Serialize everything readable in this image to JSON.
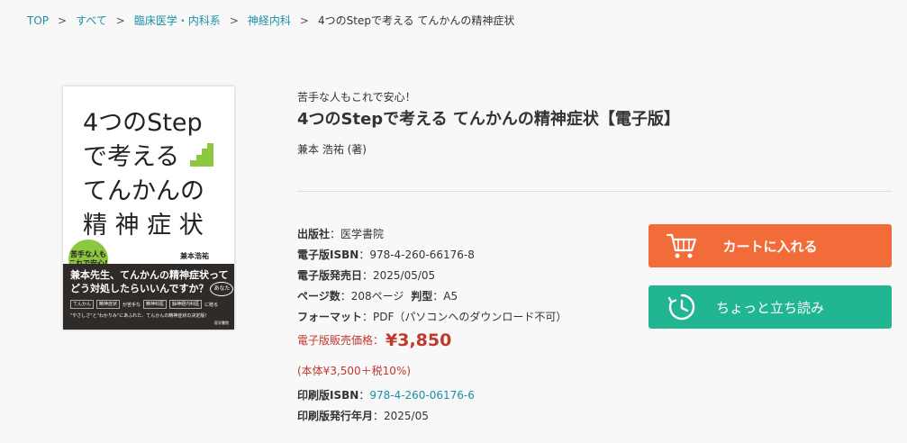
{
  "breadcrumb": {
    "items": [
      "TOP",
      "すべて",
      "臨床医学・内科系",
      "神経内科"
    ],
    "current": "4つのStepで考える てんかんの精神症状"
  },
  "cover": {
    "title_lines": [
      "4つのStep",
      "で考える",
      "てんかんの",
      "精 神 症 状"
    ],
    "badge": [
      "苦手な人も",
      "これで安心!"
    ],
    "author": "兼本浩祐",
    "band_line1": "兼本先生、てんかんの精神症状って",
    "band_line2": "どう対処したらいいんですか？",
    "band_ring": "あなた",
    "band_tags": [
      "てんかん",
      "精神症状",
      "精神科医",
      "脳神経内科医"
    ],
    "band_tag_mid": "が苦手な",
    "band_tag_end": "に贈る",
    "band_line4": "\"やさしさ\"と\"わかりみ\"にあふれた、てんかんの精神症状の決定版！",
    "band_publisher": "医学書院"
  },
  "product": {
    "subtitle": "苦手な人もこれで安心！",
    "title": "4つのStepで考える てんかんの精神症状【電子版】",
    "authors": "兼本 浩祐 (著)"
  },
  "details": {
    "publisher_label": "出版社",
    "publisher_value": "：医学書院",
    "e_isbn_label": "電子版ISBN",
    "e_isbn_value": "：978-4-260-66176-8",
    "e_release_label": "電子版発売日",
    "e_release_value": "：2025/05/05",
    "pages_label": "ページ数",
    "pages_value": "：208ページ",
    "size_label": "判型",
    "size_value": "：A5",
    "format_label": "フォーマット",
    "format_value": "：PDF（パソコンへのダウンロード不可）",
    "price_label": "電子版販売価格：",
    "price_value": "¥3,850",
    "price_breakdown": "(本体¥3,500＋税10%)",
    "print_isbn_label": "印刷版ISBN",
    "print_isbn_sep": "：",
    "print_isbn_value": "978-4-260-06176-6",
    "print_release_label": "印刷版発行年月",
    "print_release_value": "：2025/05"
  },
  "actions": {
    "cart_label": "カートに入れる",
    "preview_label": "ちょっと立ち読み"
  },
  "colors": {
    "cart": "#f26c3a",
    "preview": "#22b592",
    "link": "#1b8fa6",
    "price": "#c0392b"
  },
  "icons": {
    "cart": "shopping-cart-icon",
    "preview": "clock-icon"
  }
}
